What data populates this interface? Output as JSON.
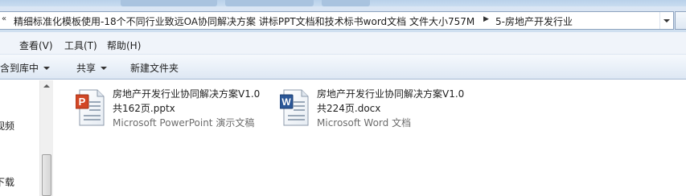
{
  "breadcrumb": {
    "path": "精细标准化模板使用-18个不同行业致远OA协同解决方案 讲标PPT文档和技术标书word文档 文件大小757M",
    "folder": "5-房地产开发行业"
  },
  "menu": {
    "view": "查看(V)",
    "tools": "工具(T)",
    "help": "帮助(H)"
  },
  "toolbar": {
    "include_in_library": "包含到库中",
    "share": "共享",
    "new_folder": "新建文件夹"
  },
  "nav": {
    "item_videos": "视频",
    "item_downloads": "下载"
  },
  "files": [
    {
      "name_line1": "房地产开发行业协同解决方案V1.0",
      "name_line2": "共162页.pptx",
      "type": "Microsoft PowerPoint 演示文稿",
      "icon": "powerpoint-file-icon"
    },
    {
      "name_line1": "房地产开发行业协同解决方案V1.0",
      "name_line2": "共224页.docx",
      "type": "Microsoft Word 文档",
      "icon": "word-file-icon"
    }
  ]
}
